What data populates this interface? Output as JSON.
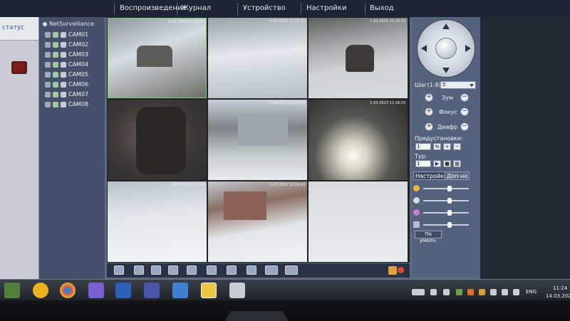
{
  "menu": {
    "items": [
      "Воспроизведение",
      "Журнал",
      "Устройство",
      "Настройки",
      "Выход"
    ]
  },
  "status": {
    "tab_label": "статус"
  },
  "tree": {
    "root": "NetSurveillance",
    "cameras": [
      "CAM01",
      "CAM02",
      "CAM03",
      "CAM04",
      "CAM05",
      "CAM06",
      "CAM07",
      "CAM08"
    ]
  },
  "grid": {
    "timestamps": [
      "1-03-2023 11:24:33",
      "1-03-2023 11:24:33",
      "1-03-2023 11:24:33",
      "1-03-2023 11:24:33",
      "1-03-2023 11:24:33",
      "1-03-2023 11:24:33",
      "1-03-2023 11:24:33",
      "1-03-2023 11:24:33"
    ]
  },
  "ptz": {
    "step_label": "Шаг(1-8):",
    "step_value": "5",
    "zoom_label": "Зум",
    "focus_label": "Фокус",
    "iris_label": "Диафр",
    "presets_label": "Предустановки:",
    "preset_value": "1",
    "tour_label": "Тур:",
    "tour_value": "1",
    "tabs": [
      "Настройки",
      "Доп-но"
    ],
    "default_button": "По умолч."
  },
  "taskbar": {
    "lang": "ENG",
    "time": "11:24",
    "date": "14.03.202"
  },
  "colors": {
    "menubar": "#1e2433",
    "panel": "#55627e",
    "tree": "#46506a",
    "selected_border": "#7fcf82"
  }
}
